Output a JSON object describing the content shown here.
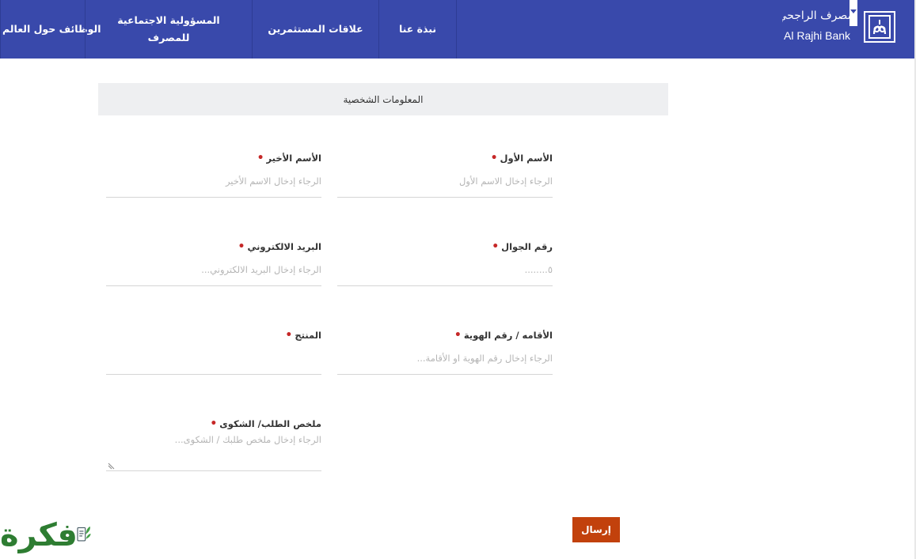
{
  "header": {
    "nav": {
      "jobs": "الوظائف حول العالم",
      "csr": "المسؤولية الاجتماعية للمصرف",
      "investors": "علاقات المستثمرين",
      "about": "نبذة عنا"
    },
    "brand_ar": "مصرف الراجحي",
    "brand_en": "Al Rajhi Bank"
  },
  "section_title": "المعلومات الشخصية",
  "form": {
    "first_name": {
      "label": "الأسم الأول",
      "placeholder": "الرجاء إدخال الاسم الأول"
    },
    "last_name": {
      "label": "الأسم الأخير",
      "placeholder": "الرجاء إدخال الاسم الأخير"
    },
    "mobile": {
      "label": "رقم الجوال",
      "placeholder": "٥........"
    },
    "email": {
      "label": "البريد الالكتروني",
      "placeholder": "الرجاء إدخال البريد الالكتروني..."
    },
    "id_number": {
      "label": "الأقامه / رقم الهوية",
      "placeholder": "الرجاء إدخال رقم الهوية او الأقامة..."
    },
    "product": {
      "label": "المنتج",
      "placeholder": ""
    },
    "summary": {
      "label": "ملخص الطلب/ الشكوى",
      "placeholder": "الرجاء إدخال ملخص طلبك / الشكوى..."
    },
    "required_mark": "•",
    "submit_label": "إرسال"
  },
  "watermark": {
    "text": "فكرة"
  },
  "colors": {
    "header_bg": "#3949ab",
    "submit_bg": "#c2410c",
    "required": "#c62828",
    "watermark": "#2e7d32"
  }
}
